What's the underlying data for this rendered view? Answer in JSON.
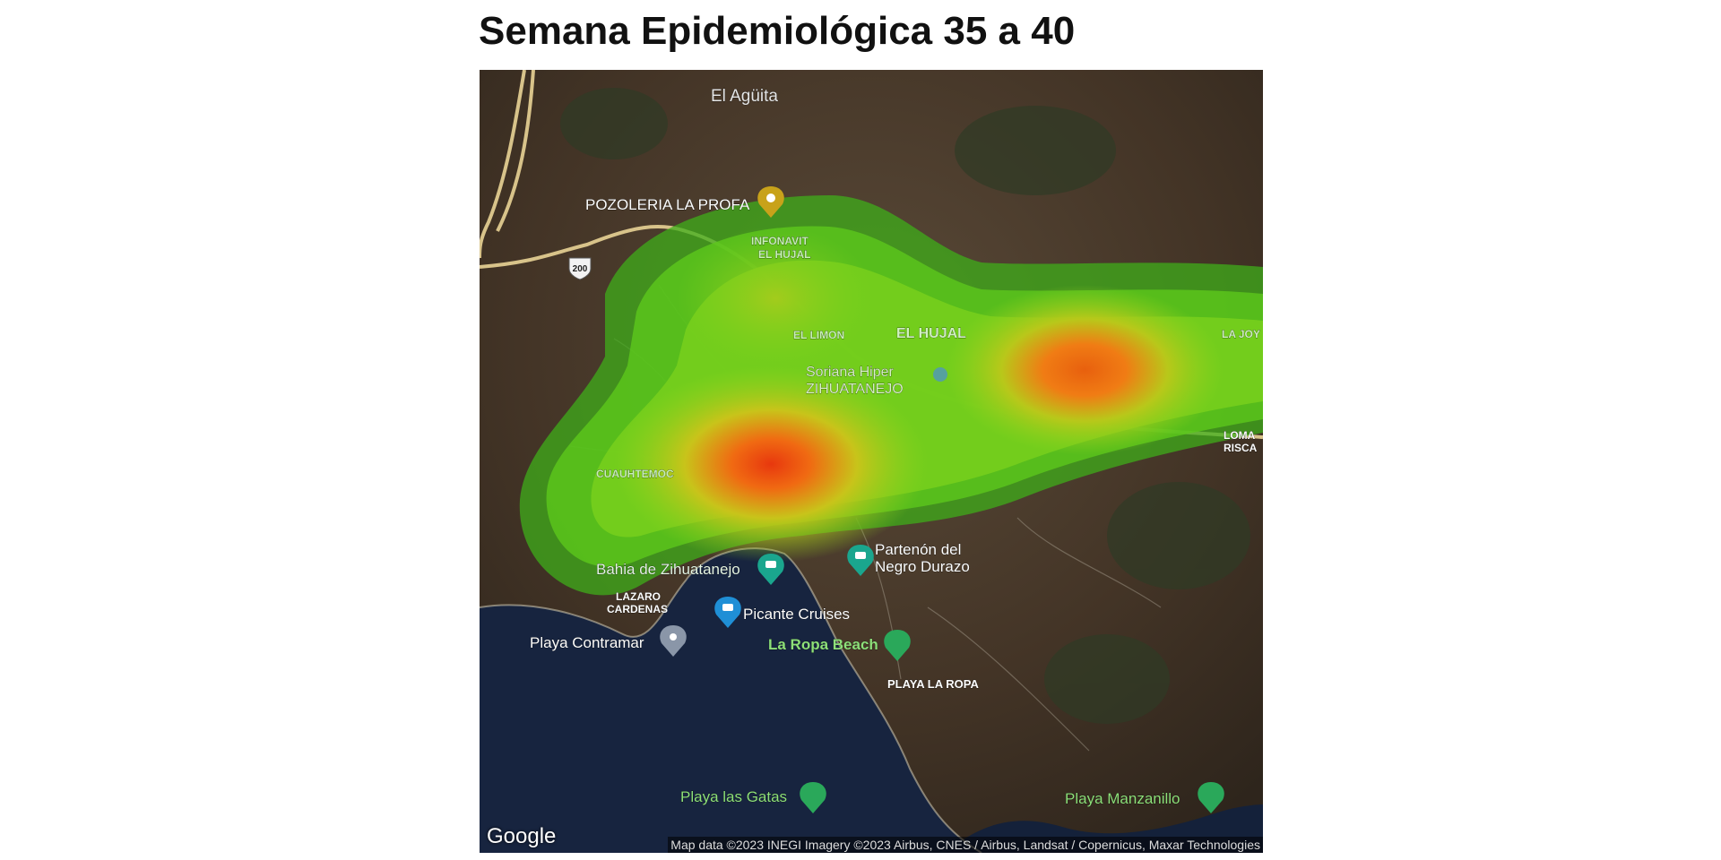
{
  "title": "Semana Epidemiológica 35 a 40",
  "map": {
    "attribution": "Map data ©2023 INEGI Imagery ©2023 Airbus, CNES / Airbus, Landsat / Copernicus, Maxar Technologies",
    "logo": "Google",
    "route_shield": "200",
    "places": {
      "el_aguita": "El Agüita",
      "pozoleria": "POZOLERIA LA PROFA",
      "infonavit": "INFONAVIT",
      "infonavit2": "EL HUJAL",
      "el_limon": "EL LIMON",
      "el_hujal": "EL HUJAL",
      "soriana1": "Soriana Hiper",
      "soriana2": "ZIHUATANEJO",
      "la_joya": "LA JOY",
      "loma1": "LOMA",
      "loma2": "RISCA",
      "cuauhtemoc": "CUAUHTEMOC",
      "bahia": "Bahia de Zihuatanejo",
      "partenon1": "Partenón del",
      "partenon2": "Negro Durazo",
      "lazaro1": "LAZARO",
      "lazaro2": "CARDENAS",
      "picante": "Picante Cruises",
      "contramar": "Playa Contramar",
      "la_ropa_beach": "La Ropa Beach",
      "playa_la_ropa": "PLAYA LA ROPA",
      "las_gatas": "Playa las Gatas",
      "manzanillo": "Playa Manzanillo"
    },
    "colors": {
      "heat_low": "#4ec21b",
      "heat_mid": "#a8d21c",
      "heat_high": "#f06a12",
      "heat_peak": "#e8380e",
      "water": "#16233d",
      "land": "#4a3a2b"
    }
  }
}
